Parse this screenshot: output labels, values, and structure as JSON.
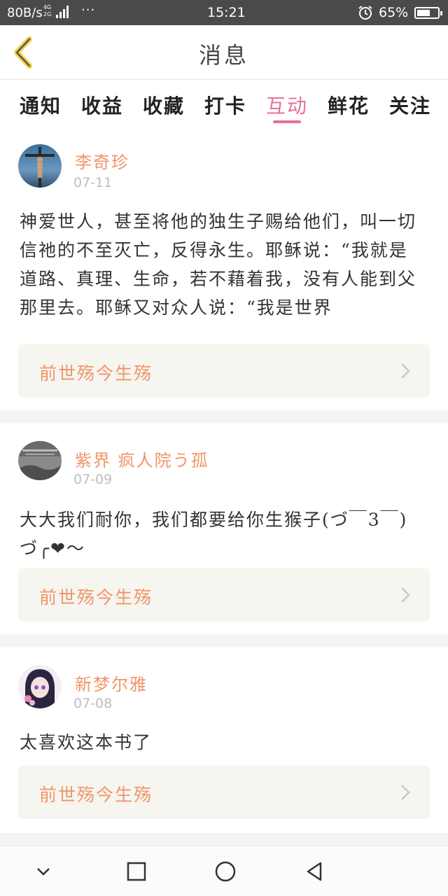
{
  "status_bar": {
    "net_speed": "80B/s",
    "signal_labels": [
      "4G",
      "2G"
    ],
    "more": "···",
    "time": "15:21",
    "battery": "65%",
    "icons": [
      "signal-icon",
      "alarm-icon",
      "battery-icon"
    ]
  },
  "header": {
    "back_icon": "chevron-left-icon",
    "title": "消息",
    "accent_color": "#f2d24c"
  },
  "tabs": [
    {
      "label": "通知",
      "active": false
    },
    {
      "label": "收益",
      "active": false
    },
    {
      "label": "收藏",
      "active": false
    },
    {
      "label": "打卡",
      "active": false
    },
    {
      "label": "互动",
      "active": true
    },
    {
      "label": "鲜花",
      "active": false
    },
    {
      "label": "关注",
      "active": false
    }
  ],
  "colors": {
    "tab_active": "#e8709a",
    "username": "#f0956a",
    "date": "#bdbdbd",
    "book_bg": "#f6f5ef"
  },
  "messages": [
    {
      "username": "李奇珍",
      "date": "07-11",
      "avatar": "crucifix-avatar",
      "comment": "神爱世人，甚至将他的独生子赐给他们，叫一切信祂的不至灭亡，反得永生。耶稣说：“我就是道路、真理、生命，若不藉着我，没有人能到父那里去。耶稣又对众人说：“我是世界",
      "book_title": "前世殇今生殇"
    },
    {
      "username": "紫界 疯人院う孤",
      "date": "07-09",
      "avatar": "grey-landscape-avatar",
      "comment": "大大我们耐你，我们都要给你生猴子(づ￣3￣)づ╭❤～",
      "book_title": "前世殇今生殇"
    },
    {
      "username": "新梦尔雅",
      "date": "07-08",
      "avatar": "anime-girl-avatar",
      "comment": "太喜欢这本书了",
      "book_title": "前世殇今生殇"
    }
  ],
  "nav_bar": {
    "icons": [
      "chevron-down-icon",
      "square-icon",
      "circle-icon",
      "triangle-back-icon"
    ]
  }
}
